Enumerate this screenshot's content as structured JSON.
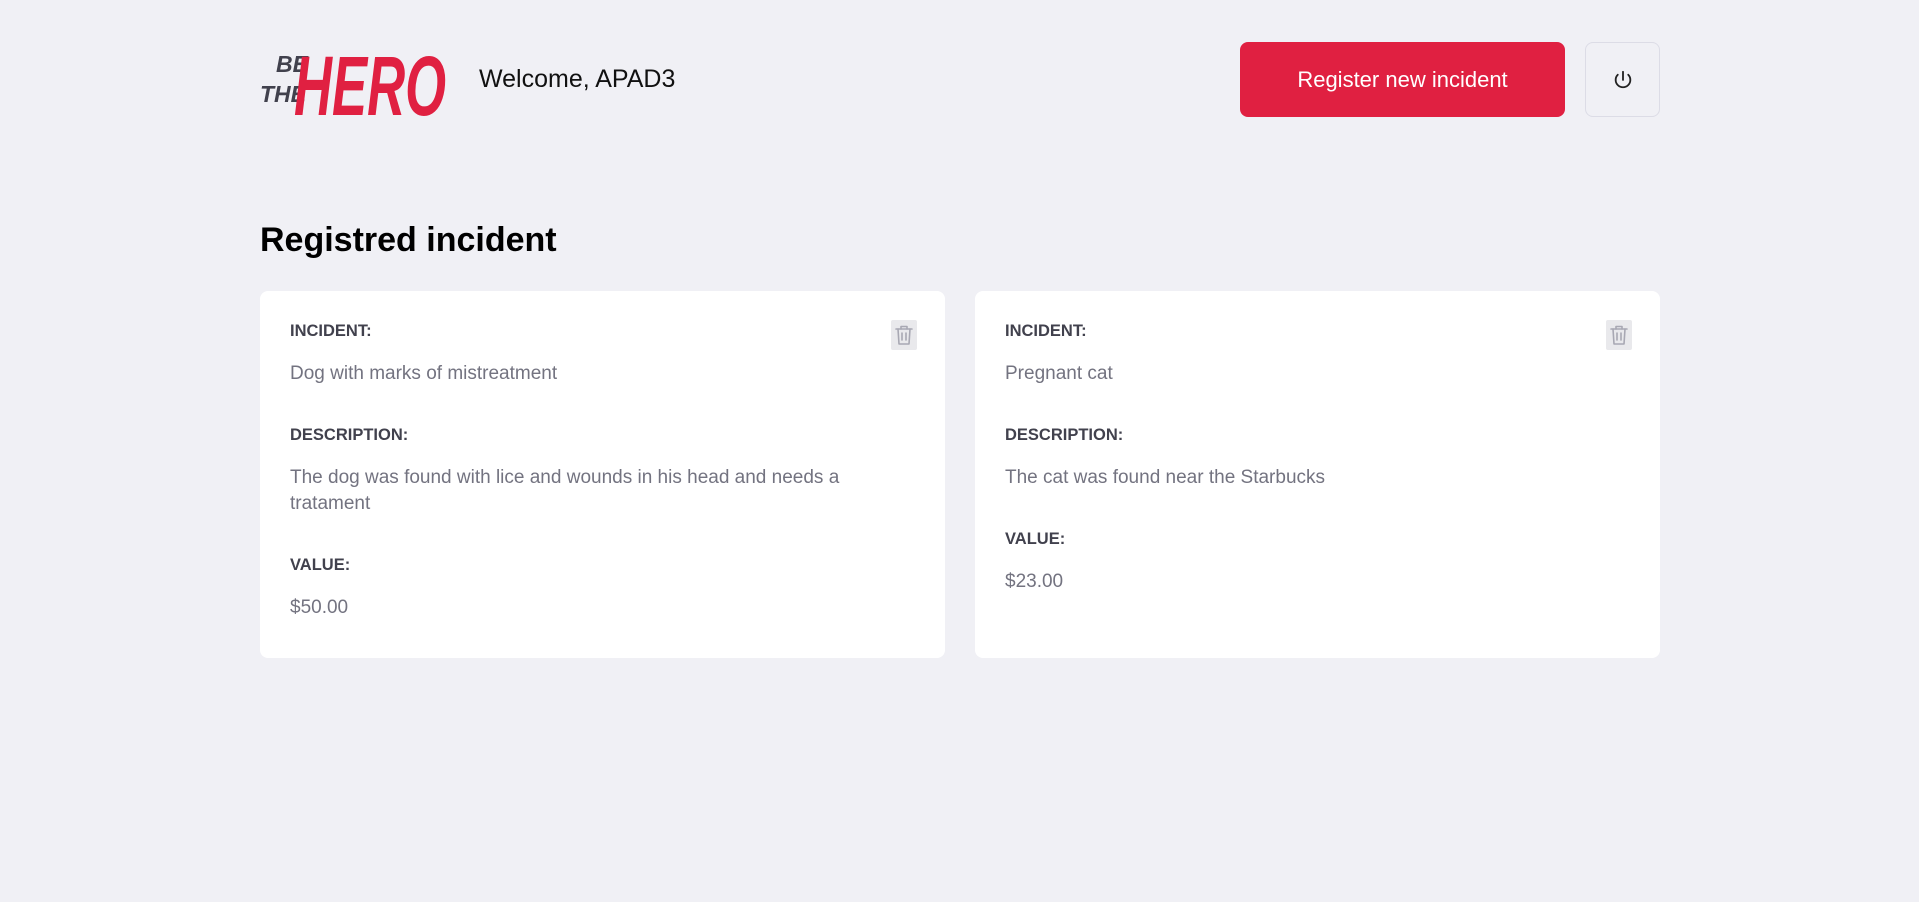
{
  "header": {
    "logo": {
      "line1": "BE",
      "line2": "THE",
      "word": "HERO"
    },
    "welcome": "Welcome, APAD3",
    "register_button": "Register new incident",
    "logout_icon": "power-icon"
  },
  "main": {
    "title": "Registred incident",
    "incidents": [
      {
        "incident_label": "INCIDENT:",
        "incident": "Dog with marks of mistreatment",
        "description_label": "DESCRIPTION:",
        "description": "The dog was found with lice and wounds in his head and needs a tratament",
        "value_label": "VALUE:",
        "value": "$50.00",
        "delete_icon": "trash-icon"
      },
      {
        "incident_label": "INCIDENT:",
        "incident": "Pregnant cat",
        "description_label": "DESCRIPTION:",
        "description": "The cat was found near the Starbucks",
        "value_label": "VALUE:",
        "value": "$23.00",
        "delete_icon": "trash-icon"
      }
    ]
  },
  "colors": {
    "background": "#f0f0f5",
    "accent": "#e02041",
    "logo_dark": "#41414d",
    "label": "#41414d",
    "muted_text": "#737380",
    "card": "#ffffff"
  }
}
